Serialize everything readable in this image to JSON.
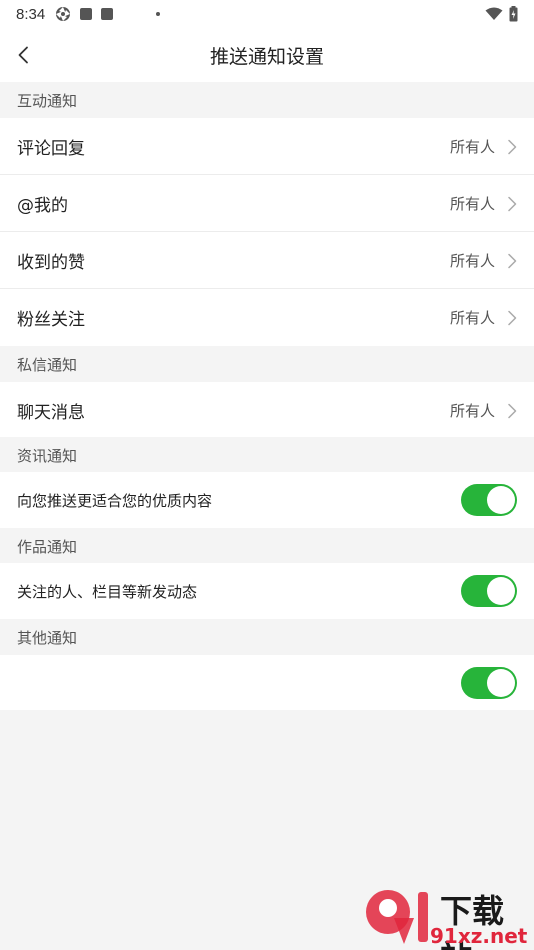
{
  "status_bar": {
    "time": "8:34"
  },
  "header": {
    "title": "推送通知设置"
  },
  "sections": {
    "interaction": {
      "title": "互动通知",
      "items": [
        {
          "label": "评论回复",
          "value": "所有人"
        },
        {
          "label": "@我的",
          "value": "所有人"
        },
        {
          "label": "收到的赞",
          "value": "所有人"
        },
        {
          "label": "粉丝关注",
          "value": "所有人"
        }
      ]
    },
    "private_message": {
      "title": "私信通知",
      "items": [
        {
          "label": "聊天消息",
          "value": "所有人"
        }
      ]
    },
    "news": {
      "title": "资讯通知",
      "toggle_label": "向您推送更适合您的优质内容",
      "toggle_on": true
    },
    "works": {
      "title": "作品通知",
      "toggle_label": "关注的人、栏目等新发动态",
      "toggle_on": true
    },
    "other": {
      "title": "其他通知",
      "toggle_label": "",
      "toggle_on": true
    }
  },
  "watermark": {
    "brand": "下载站",
    "domain": "91xz.net"
  },
  "colors": {
    "toggle_on": "#27b43a",
    "watermark_red": "#e0263c"
  }
}
